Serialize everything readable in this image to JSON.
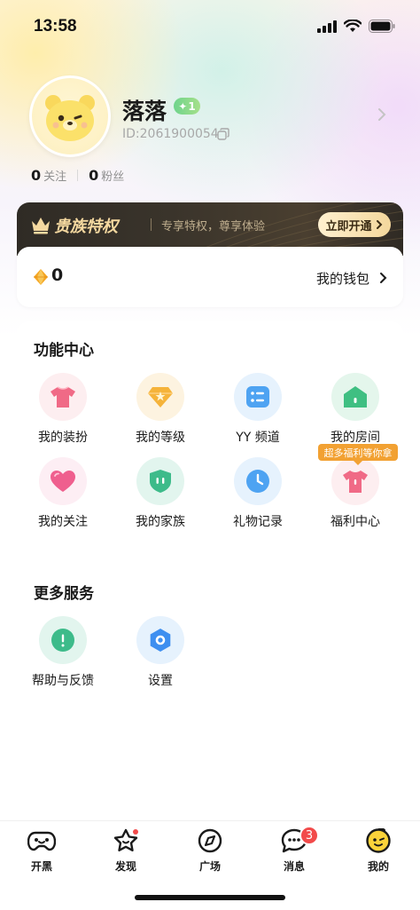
{
  "status_bar": {
    "time": "13:58"
  },
  "profile": {
    "nickname": "落落",
    "level": "1",
    "user_id": "ID:2061900054",
    "following_count": "0",
    "following_label": "关注",
    "fans_count": "0",
    "fans_label": "粉丝"
  },
  "noble": {
    "title": "贵族特权",
    "subtitle": "专享特权，尊享体验",
    "button_label": "立即开通"
  },
  "wallet": {
    "balance": "0",
    "link_label": "我的钱包"
  },
  "function_center": {
    "title": "功能中心",
    "items": [
      {
        "label": "我的装扮",
        "icon": "outfit-icon"
      },
      {
        "label": "我的等级",
        "icon": "level-icon"
      },
      {
        "label": "YY 频道",
        "icon": "channel-icon"
      },
      {
        "label": "我的房间",
        "icon": "room-icon"
      },
      {
        "label": "我的关注",
        "icon": "heart-icon"
      },
      {
        "label": "我的家族",
        "icon": "family-icon"
      },
      {
        "label": "礼物记录",
        "icon": "clock-icon"
      },
      {
        "label": "福利中心",
        "icon": "gift-icon"
      }
    ],
    "welfare_tag": "超多福利等你拿"
  },
  "more_services": {
    "title": "更多服务",
    "items": [
      {
        "label": "帮助与反馈",
        "icon": "help-icon"
      },
      {
        "label": "设置",
        "icon": "settings-icon"
      }
    ]
  },
  "tabbar": {
    "items": [
      {
        "label": "开黑",
        "icon": "gamepad-icon"
      },
      {
        "label": "发现",
        "icon": "star-icon"
      },
      {
        "label": "广场",
        "icon": "compass-icon"
      },
      {
        "label": "消息",
        "icon": "chat-icon",
        "badge": "3"
      },
      {
        "label": "我的",
        "icon": "profile-face-icon"
      }
    ]
  },
  "colors": {
    "accent_gold": "#f5d9a0",
    "badge_red": "#f24a4a",
    "welfare_orange": "#f2a132",
    "level_green": "#6fd48c"
  }
}
